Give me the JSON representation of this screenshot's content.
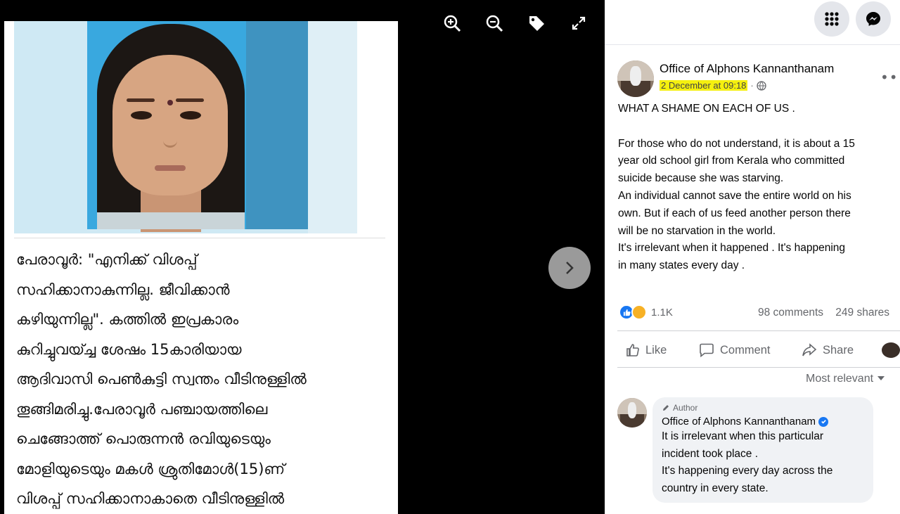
{
  "article": {
    "lines": [
      "പേരാവൂർ: \"എനിക്ക് വിശപ്പ്",
      "സഹിക്കാനാകുന്നില്ല. ജീവിക്കാൻ",
      "കഴിയുന്നില്ല\". കത്തിൽ ഇപ്രകാരം",
      "കുറിച്ചുവയ്ച്ച ശേഷം 15കാരിയായ",
      "ആദിവാസി പെൺകുട്ടി സ്വന്തം വീടിനുള്ളിൽ",
      "തൂങ്ങിമരിച്ചു.പേരാവൂർ പഞ്ചായത്തിലെ",
      "ചെങ്ങോത്ത് പൊരുന്നൻ രവിയുടെയും",
      "മോളിയുടെയും മകൾ ശ്രുതിമോൾ(15)ണ്",
      "വിശപ്പ് സഹിക്കാനാകാതെ വീടിനുള്ളിൽ"
    ]
  },
  "viewer_tools": {
    "icons": [
      "zoom-in-icon",
      "zoom-out-icon",
      "tag-icon",
      "fullscreen-icon"
    ]
  },
  "post": {
    "author": "Office of Alphons Kannanthanam",
    "timestamp": "2 December at 09:18",
    "separator": "·",
    "text_lines": [
      "WHAT A SHAME ON EACH OF US .",
      "",
      "For those who do not understand, it is about a 15",
      "year old school girl from Kerala who committed",
      "suicide because she was starving.",
      "An individual cannot save the entire world on his",
      "own. But if each of us feed another person there",
      "will be no starvation in the world.",
      "It's irrelevant when it happened . It's happening",
      "in many states every day ."
    ],
    "reaction_count": "1.1K",
    "comments_count": "98 comments",
    "shares_count": "249 shares",
    "actions": {
      "like": "Like",
      "comment": "Comment",
      "share": "Share"
    },
    "sort_label": "Most relevant"
  },
  "comment": {
    "tag": "Author",
    "name": "Office of Alphons Kannanthanam",
    "lines": [
      "It is irrelevant when this particular",
      "incident took place .",
      "It's happening every day across the",
      "country in every state."
    ]
  },
  "colors": {
    "facebook_blue": "#1877f2",
    "highlight": "#f5f00f"
  }
}
